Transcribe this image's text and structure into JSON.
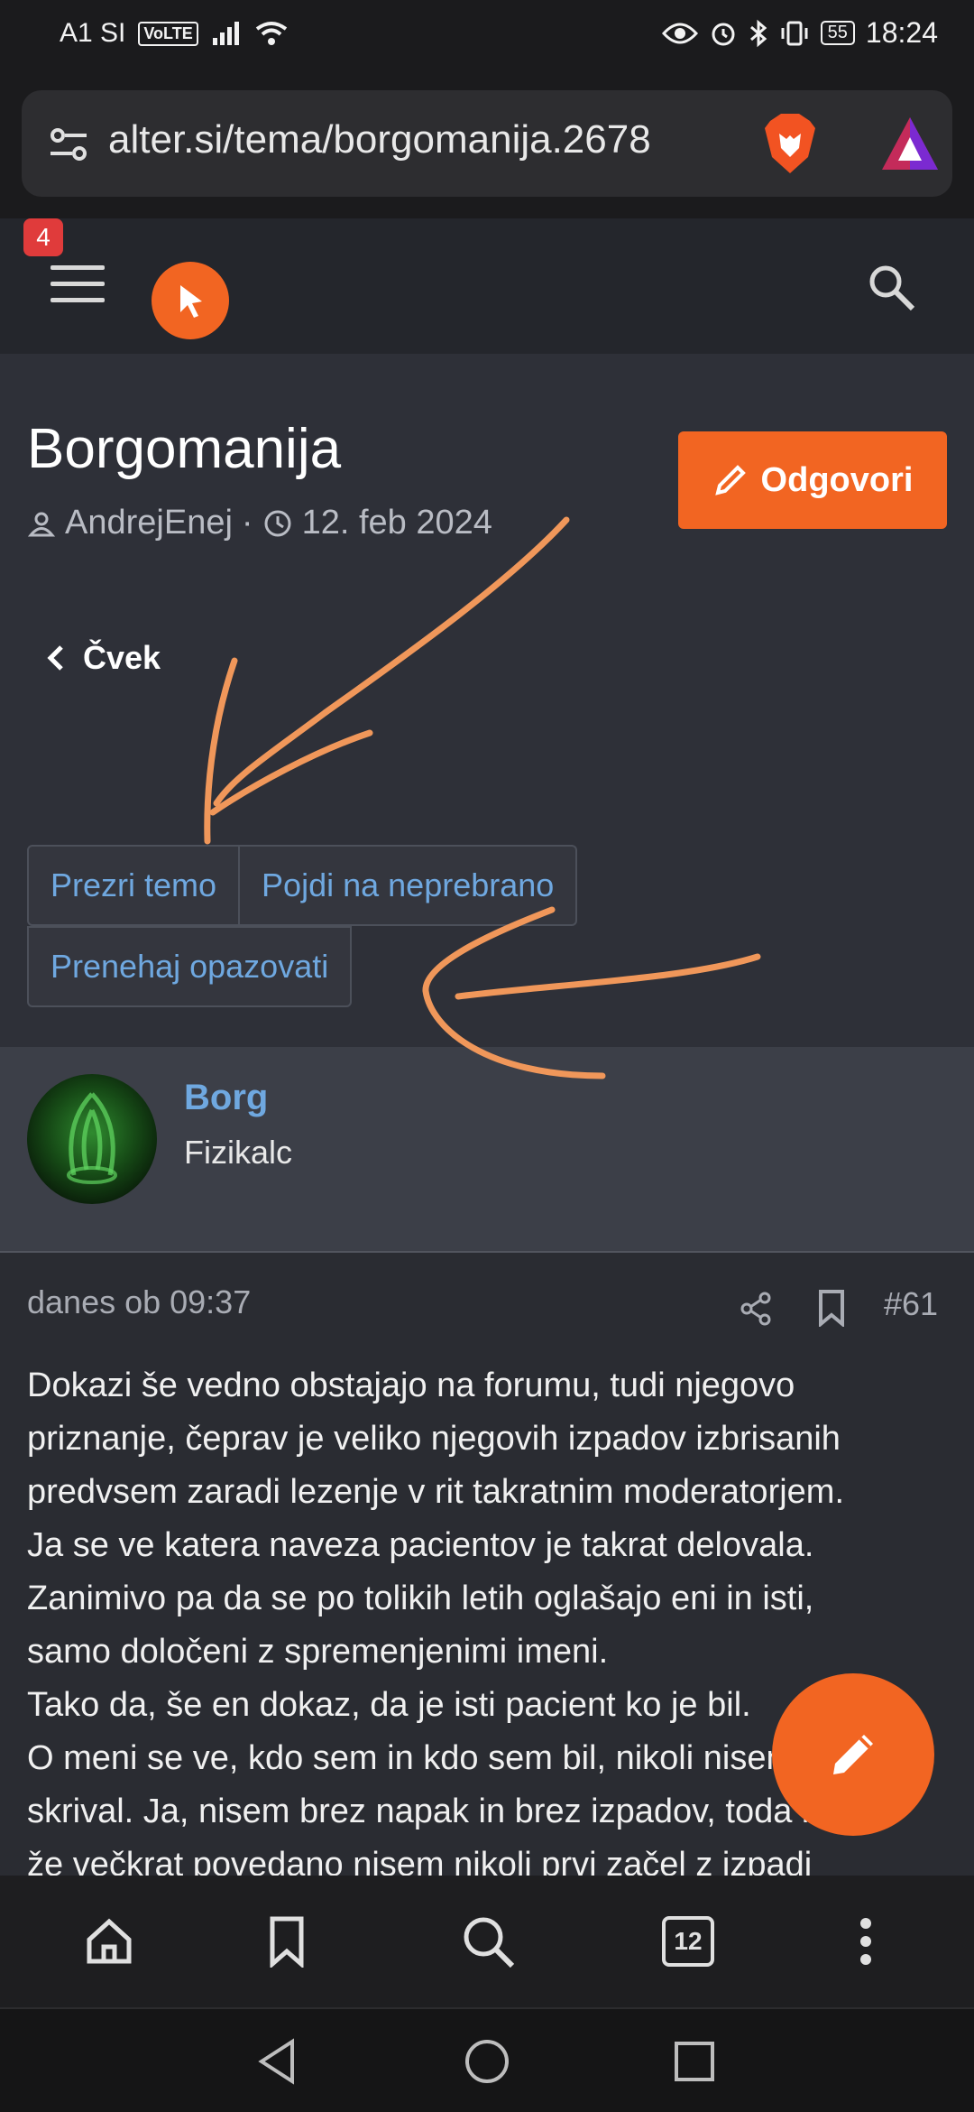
{
  "status_bar": {
    "carrier": "A1 SI",
    "volte": "VoLTE",
    "battery": "55",
    "time": "18:24"
  },
  "browser": {
    "url": "alter.si/tema/borgomanija.2678",
    "tab_count": "12"
  },
  "site_header": {
    "notification_count": "4"
  },
  "thread": {
    "title": "Borgomanija",
    "author": "AndrejEnej",
    "separator": "·",
    "date": "12. feb 2024",
    "reply_label": "Odgovori",
    "back_label": "Čvek",
    "buttons": {
      "ignore": "Prezri temo",
      "unread": "Pojdi na neprebrano",
      "unwatch": "Prenehaj opazovati"
    }
  },
  "post": {
    "username": "Borg",
    "user_title": "Fizikalc",
    "date": "danes ob 09:37",
    "number": "#61",
    "lines": [
      "Dokazi še vedno obstajajo na forumu, tudi njegovo",
      "priznanje, čeprav je veliko njegovih izpadov izbrisanih",
      "predvsem zaradi lezenje v rit takratnim moderatorjem.",
      "Ja se ve katera naveza pacientov je takrat delovala.",
      "Zanimivo pa da se po tolikih letih oglašajo eni in isti,",
      "samo določeni z spremenjenimi imeni.",
      "Tako da, še en dokaz, da je isti pacient ko je bil.",
      "O meni se ve, kdo sem in kdo sem bil, nikoli nisem",
      "skrival. Ja, nisem brez napak in brez izpadov, toda kot",
      "že večkrat povedano nisem nikoli prvi začel z izpadi"
    ]
  },
  "colors": {
    "accent": "#f26522",
    "link": "#6fa8e0",
    "annotation": "#f0975a"
  }
}
